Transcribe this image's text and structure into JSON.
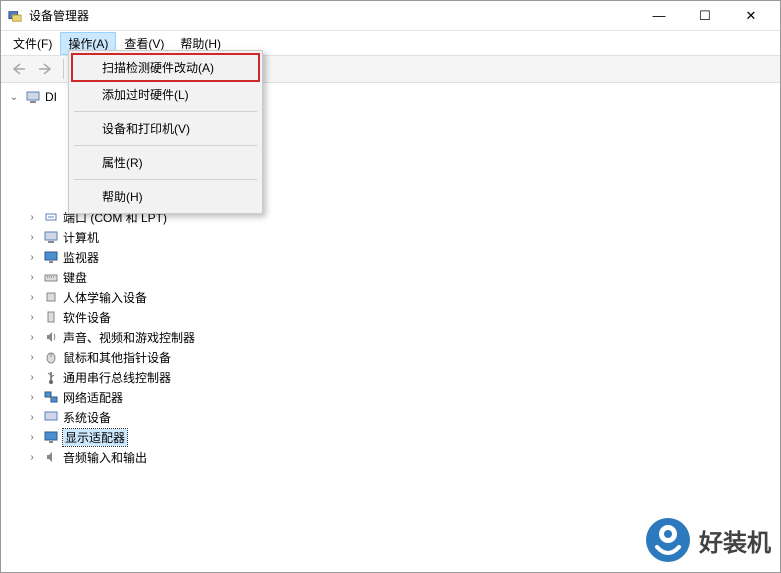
{
  "titlebar": {
    "title": "设备管理器"
  },
  "window_controls": {
    "minimize": "—",
    "maximize": "☐",
    "close": "✕"
  },
  "menubar": {
    "file": "文件(F)",
    "action": "操作(A)",
    "view": "查看(V)",
    "help": "帮助(H)"
  },
  "context_menu": {
    "scan_hardware": "扫描检测硬件改动(A)",
    "add_legacy": "添加过时硬件(L)",
    "devices_printers": "设备和打印机(V)",
    "properties": "属性(R)",
    "help": "帮助(H)"
  },
  "tree": {
    "root": "DI",
    "ports": "端口 (COM 和 LPT)",
    "computer": "计算机",
    "monitor": "监视器",
    "keyboard": "键盘",
    "hid": "人体学输入设备",
    "software_devices": "软件设备",
    "sound": "声音、视频和游戏控制器",
    "mouse": "鼠标和其他指针设备",
    "usb": "通用串行总线控制器",
    "network": "网络适配器",
    "system": "系统设备",
    "display": "显示适配器",
    "audio_io": "音频输入和输出"
  },
  "watermark": {
    "text": "好装机"
  }
}
